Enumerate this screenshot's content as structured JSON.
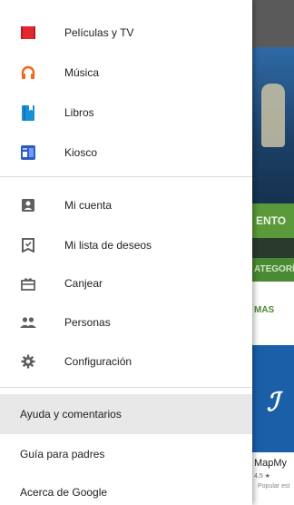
{
  "drawer": {
    "primary_items": [
      {
        "label": "Películas y TV",
        "icon": "movies-tv-icon",
        "color": "#e0282e"
      },
      {
        "label": "Música",
        "icon": "headphones-icon",
        "color": "#f4661b"
      },
      {
        "label": "Libros",
        "icon": "books-icon",
        "color": "#1a8fd6"
      },
      {
        "label": "Kiosco",
        "icon": "newsstand-icon",
        "color": "#2f5bbd"
      }
    ],
    "account_items": [
      {
        "label": "Mi cuenta",
        "icon": "account-icon"
      },
      {
        "label": "Mi lista de deseos",
        "icon": "wishlist-icon"
      },
      {
        "label": "Canjear",
        "icon": "redeem-icon"
      },
      {
        "label": "Personas",
        "icon": "people-icon"
      },
      {
        "label": "Configuración",
        "icon": "settings-icon"
      }
    ],
    "footer_items": [
      {
        "label": "Ayuda y comentarios",
        "active": true
      },
      {
        "label": "Guía para padres"
      },
      {
        "label": "Acerca de Google"
      }
    ]
  },
  "background": {
    "green_button_text": "ENTO",
    "category_text": "ATEGORÍ",
    "more_text": "MÁS",
    "card_title": "MapMy",
    "card_rating": "4,5 ★",
    "card_sub": "Popular est"
  },
  "colors": {
    "drawer_bg": "#ffffff",
    "icon_gray": "#5f5f5f",
    "active_bg": "#e8e8e8",
    "accent_green": "#5b9a3a"
  }
}
